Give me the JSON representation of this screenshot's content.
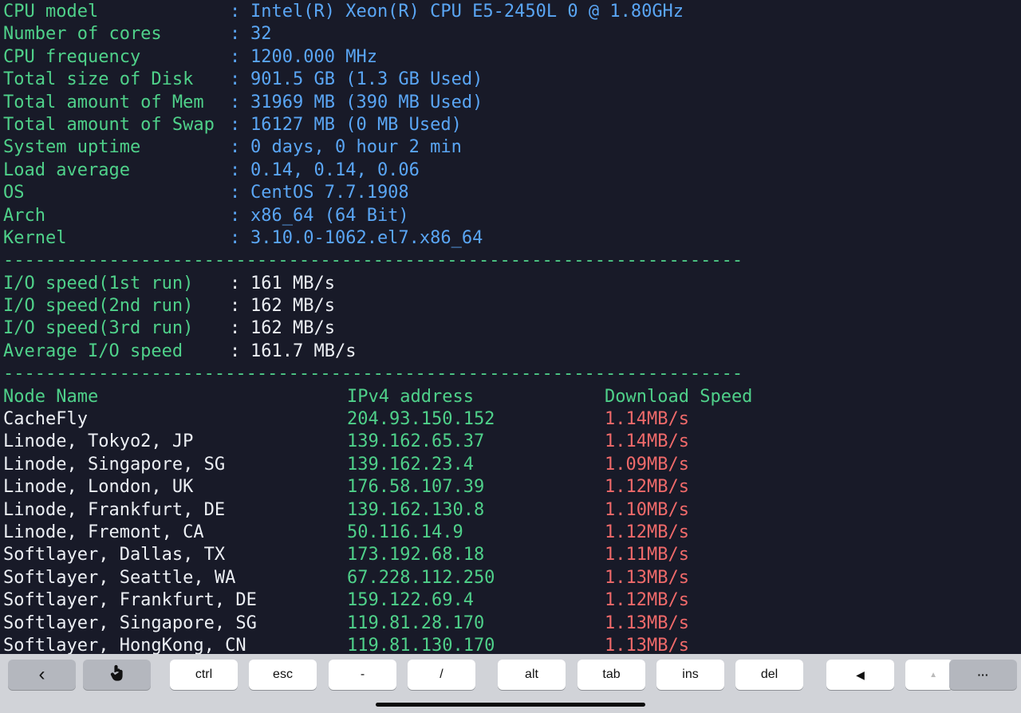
{
  "terminal": {
    "sysinfo": [
      {
        "label": "CPU model           ",
        "sep": ": ",
        "value": "Intel(R) Xeon(R) CPU E5-2450L 0 @ 1.80GHz"
      },
      {
        "label": "Number of cores     ",
        "sep": ": ",
        "value": "32"
      },
      {
        "label": "CPU frequency       ",
        "sep": ": ",
        "value": "1200.000 MHz"
      },
      {
        "label": "Total size of Disk  ",
        "sep": ": ",
        "value": "901.5 GB (1.3 GB Used)"
      },
      {
        "label": "Total amount of Mem ",
        "sep": ": ",
        "value": "31969 MB (390 MB Used)"
      },
      {
        "label": "Total amount of Swap",
        "sep": ": ",
        "value": "16127 MB (0 MB Used)"
      },
      {
        "label": "System uptime       ",
        "sep": ": ",
        "value": "0 days, 0 hour 2 min"
      },
      {
        "label": "Load average        ",
        "sep": ": ",
        "value": "0.14, 0.14, 0.06"
      },
      {
        "label": "OS                  ",
        "sep": ": ",
        "value": "CentOS 7.7.1908"
      },
      {
        "label": "Arch                ",
        "sep": ": ",
        "value": "x86_64 (64 Bit)"
      },
      {
        "label": "Kernel              ",
        "sep": ": ",
        "value": "3.10.0-1062.el7.x86_64"
      }
    ],
    "divider": "----------------------------------------------------------------------",
    "io": [
      {
        "label": "I/O speed(1st run)  ",
        "sep": ": ",
        "value": "161 MB/s"
      },
      {
        "label": "I/O speed(2nd run)  ",
        "sep": ": ",
        "value": "162 MB/s"
      },
      {
        "label": "I/O speed(3rd run)  ",
        "sep": ": ",
        "value": "162 MB/s"
      },
      {
        "label": "Average I/O speed   ",
        "sep": ": ",
        "value": "161.7 MB/s"
      }
    ],
    "speed_header": {
      "node": "Node Name",
      "ip": "IPv4 address",
      "speed": "Download Speed"
    },
    "speed_rows": [
      {
        "node": "CacheFly",
        "ip": "204.93.150.152",
        "speed": "1.14MB/s"
      },
      {
        "node": "Linode, Tokyo2, JP",
        "ip": "139.162.65.37",
        "speed": "1.14MB/s"
      },
      {
        "node": "Linode, Singapore, SG",
        "ip": "139.162.23.4",
        "speed": "1.09MB/s"
      },
      {
        "node": "Linode, London, UK",
        "ip": "176.58.107.39",
        "speed": "1.12MB/s"
      },
      {
        "node": "Linode, Frankfurt, DE",
        "ip": "139.162.130.8",
        "speed": "1.10MB/s"
      },
      {
        "node": "Linode, Fremont, CA",
        "ip": "50.116.14.9",
        "speed": "1.12MB/s"
      },
      {
        "node": "Softlayer, Dallas, TX",
        "ip": "173.192.68.18",
        "speed": "1.11MB/s"
      },
      {
        "node": "Softlayer, Seattle, WA",
        "ip": "67.228.112.250",
        "speed": "1.13MB/s"
      },
      {
        "node": "Softlayer, Frankfurt, DE",
        "ip": "159.122.69.4",
        "speed": "1.12MB/s"
      },
      {
        "node": "Softlayer, Singapore, SG",
        "ip": "119.81.28.170",
        "speed": "1.13MB/s"
      },
      {
        "node": "Softlayer, HongKong, CN",
        "ip": "119.81.130.170",
        "speed": "1.13MB/s"
      }
    ]
  },
  "keybar": {
    "back_glyph": "‹",
    "touch_icon": "hand-pointer-icon",
    "ctrl": "ctrl",
    "esc": "esc",
    "dash": "-",
    "slash": "/",
    "alt": "alt",
    "tab": "tab",
    "ins": "ins",
    "del": "del",
    "left_arrow": "◀",
    "up_arrow": "▲",
    "more": "···"
  },
  "colors": {
    "terminal_bg": "#181a28",
    "green": "#4fd18a",
    "blue": "#5aa6f5",
    "white": "#eceff4",
    "red": "#f06a6a",
    "keybar_bg": "#d1d3d8"
  }
}
